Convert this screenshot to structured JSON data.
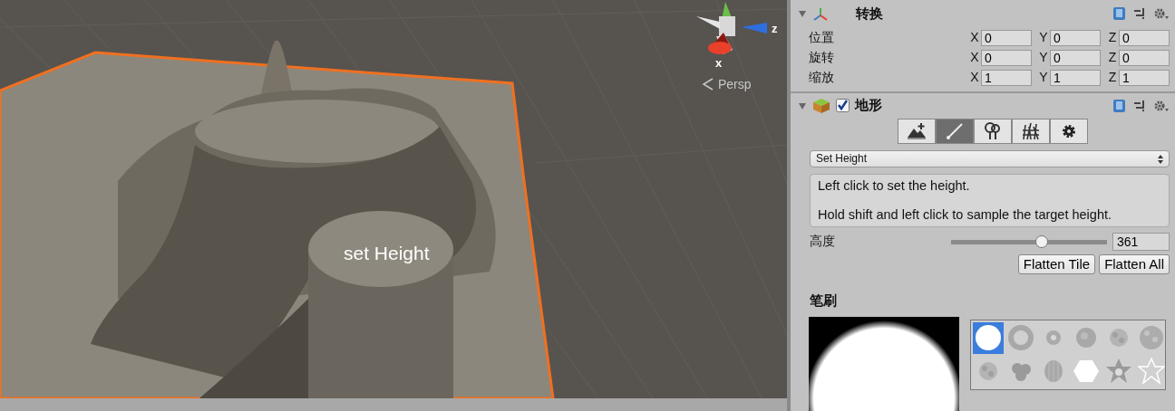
{
  "scene": {
    "gizmo_labels": [
      "z",
      "x"
    ],
    "view_mode": "Persp",
    "annotation": "set Height"
  },
  "transform": {
    "title": "转换",
    "expanded": true,
    "rows": [
      {
        "label": "位置",
        "fields": [
          {
            "axis": "X",
            "value": "0"
          },
          {
            "axis": "Y",
            "value": "0"
          },
          {
            "axis": "Z",
            "value": "0"
          }
        ]
      },
      {
        "label": "旋转",
        "fields": [
          {
            "axis": "X",
            "value": "0"
          },
          {
            "axis": "Y",
            "value": "0"
          },
          {
            "axis": "Z",
            "value": "0"
          }
        ]
      },
      {
        "label": "缩放",
        "fields": [
          {
            "axis": "X",
            "value": "1"
          },
          {
            "axis": "Y",
            "value": "1"
          },
          {
            "axis": "Z",
            "value": "1"
          }
        ]
      }
    ]
  },
  "terrain": {
    "title": "地形",
    "expanded": true,
    "enabled": true,
    "tools": [
      {
        "kind": "raise",
        "selected": false
      },
      {
        "kind": "paint",
        "selected": true
      },
      {
        "kind": "trees",
        "selected": false
      },
      {
        "kind": "details",
        "selected": false
      },
      {
        "kind": "settings",
        "selected": false
      }
    ],
    "mode": "Set Height",
    "help": [
      "Left click to set the height.",
      "Hold shift and left click to sample the target height."
    ],
    "height": {
      "label": "高度",
      "level": 0.58,
      "value": "361"
    },
    "buttons": [
      "Flatten Tile",
      "Flatten All"
    ],
    "brush_title": "笔刷",
    "brushes": [
      {
        "kind": "circle",
        "selected": true
      },
      {
        "kind": "ring",
        "selected": false
      },
      {
        "kind": "dot",
        "selected": false
      },
      {
        "kind": "blob",
        "selected": false
      },
      {
        "kind": "speckle",
        "selected": false
      },
      {
        "kind": "noise",
        "selected": false
      },
      {
        "kind": "speckle",
        "selected": false
      },
      {
        "kind": "cloud",
        "selected": false
      },
      {
        "kind": "stripes",
        "selected": false
      },
      {
        "kind": "hexagon",
        "selected": false
      },
      {
        "kind": "star",
        "selected": false
      },
      {
        "kind": "star-outline",
        "selected": false
      }
    ]
  }
}
